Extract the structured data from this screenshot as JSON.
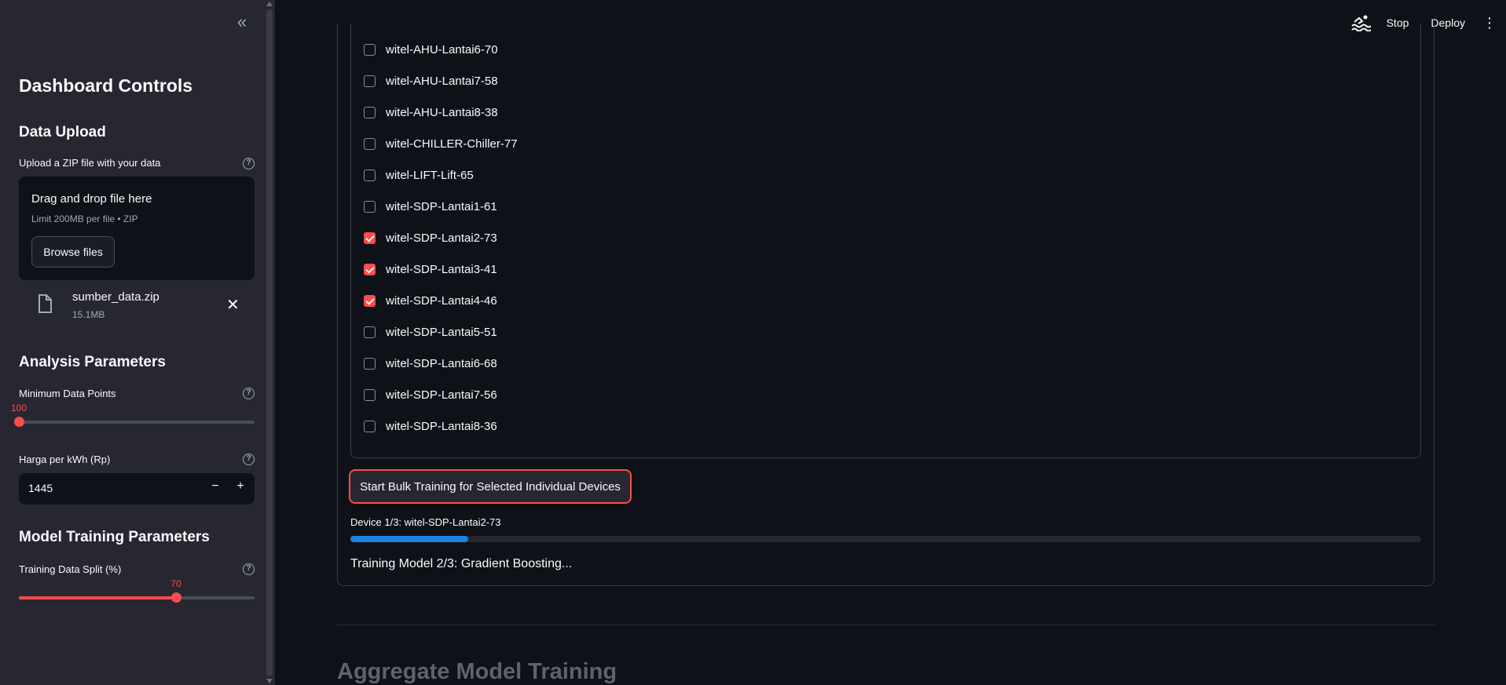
{
  "header": {
    "stop_label": "Stop",
    "deploy_label": "Deploy"
  },
  "sidebar": {
    "title": "Dashboard Controls",
    "data_upload": {
      "heading": "Data Upload",
      "upload_label": "Upload a ZIP file with your data",
      "dropzone_title": "Drag and drop file here",
      "dropzone_limit": "Limit 200MB per file • ZIP",
      "browse_label": "Browse files",
      "file_name": "sumber_data.zip",
      "file_size": "15.1MB"
    },
    "analysis": {
      "heading": "Analysis Parameters",
      "min_points_label": "Minimum Data Points",
      "min_points_value": "100",
      "min_points_fraction": 0.0,
      "price_label": "Harga per kWh (Rp)",
      "price_value": "1445"
    },
    "training": {
      "heading": "Model Training Parameters",
      "split_label": "Training Data Split (%)",
      "split_value": "70",
      "split_fraction": 0.667
    }
  },
  "devices": [
    {
      "label": "witel-AHU-Lantai6-70",
      "checked": false
    },
    {
      "label": "witel-AHU-Lantai7-58",
      "checked": false
    },
    {
      "label": "witel-AHU-Lantai8-38",
      "checked": false
    },
    {
      "label": "witel-CHILLER-Chiller-77",
      "checked": false
    },
    {
      "label": "witel-LIFT-Lift-65",
      "checked": false
    },
    {
      "label": "witel-SDP-Lantai1-61",
      "checked": false
    },
    {
      "label": "witel-SDP-Lantai2-73",
      "checked": true
    },
    {
      "label": "witel-SDP-Lantai3-41",
      "checked": true
    },
    {
      "label": "witel-SDP-Lantai4-46",
      "checked": true
    },
    {
      "label": "witel-SDP-Lantai5-51",
      "checked": false
    },
    {
      "label": "witel-SDP-Lantai6-68",
      "checked": false
    },
    {
      "label": "witel-SDP-Lantai7-56",
      "checked": false
    },
    {
      "label": "witel-SDP-Lantai8-36",
      "checked": false
    }
  ],
  "main": {
    "bulk_button_label": "Start Bulk Training for Selected Individual Devices",
    "progress_label": "Device 1/3: witel-SDP-Lantai2-73",
    "progress_fraction": 0.11,
    "training_status": "Training Model 2/3: Gradient Boosting...",
    "aggregate_title": "Aggregate Model Training"
  },
  "colors": {
    "accent": "#ff4b4b",
    "progress": "#1c83e1",
    "sidebar_bg": "#262730",
    "main_bg": "#0e1117"
  }
}
